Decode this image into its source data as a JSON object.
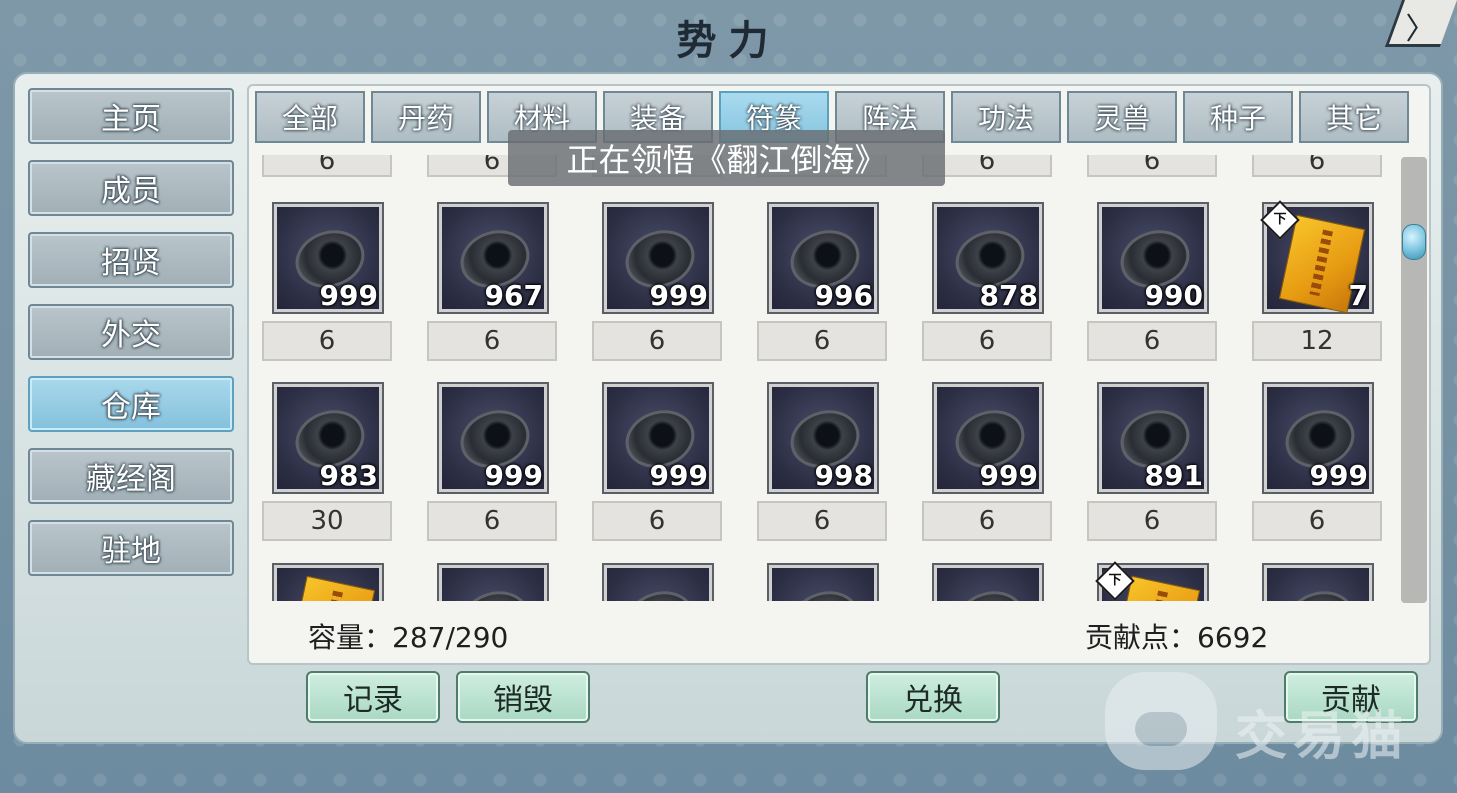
{
  "header": {
    "title": "势力",
    "close_symbol": "〉"
  },
  "sidebar": {
    "items": [
      {
        "label": "主页",
        "active": false
      },
      {
        "label": "成员",
        "active": false
      },
      {
        "label": "招贤",
        "active": false
      },
      {
        "label": "外交",
        "active": false
      },
      {
        "label": "仓库",
        "active": true
      },
      {
        "label": "藏经阁",
        "active": false
      },
      {
        "label": "驻地",
        "active": false
      }
    ]
  },
  "tabs": [
    {
      "label": "全部",
      "active": false
    },
    {
      "label": "丹药",
      "active": false
    },
    {
      "label": "材料",
      "active": false
    },
    {
      "label": "装备",
      "active": false
    },
    {
      "label": "符篆",
      "active": true
    },
    {
      "label": "阵法",
      "active": false
    },
    {
      "label": "功法",
      "active": false
    },
    {
      "label": "灵兽",
      "active": false
    },
    {
      "label": "种子",
      "active": false
    },
    {
      "label": "其它",
      "active": false
    }
  ],
  "toast": "正在领悟《翻江倒海》",
  "grid": {
    "top_costs": [
      "6",
      "6",
      "",
      "",
      "6",
      "6",
      "6"
    ],
    "rows": [
      [
        {
          "icon": "stone-icon",
          "qty": "999",
          "cost": "6",
          "tag": ""
        },
        {
          "icon": "stone-icon",
          "qty": "967",
          "cost": "6",
          "tag": ""
        },
        {
          "icon": "stone-icon",
          "qty": "999",
          "cost": "6",
          "tag": ""
        },
        {
          "icon": "stone-icon",
          "qty": "996",
          "cost": "6",
          "tag": ""
        },
        {
          "icon": "stone-icon",
          "qty": "878",
          "cost": "6",
          "tag": ""
        },
        {
          "icon": "stone-icon",
          "qty": "990",
          "cost": "6",
          "tag": ""
        },
        {
          "icon": "talisman-icon",
          "qty": "7",
          "cost": "12",
          "tag": "下"
        }
      ],
      [
        {
          "icon": "stone-icon",
          "qty": "983",
          "cost": "30",
          "tag": ""
        },
        {
          "icon": "stone-icon",
          "qty": "999",
          "cost": "6",
          "tag": ""
        },
        {
          "icon": "stone-icon",
          "qty": "999",
          "cost": "6",
          "tag": ""
        },
        {
          "icon": "stone-icon",
          "qty": "998",
          "cost": "6",
          "tag": ""
        },
        {
          "icon": "stone-icon",
          "qty": "999",
          "cost": "6",
          "tag": ""
        },
        {
          "icon": "stone-icon",
          "qty": "891",
          "cost": "6",
          "tag": ""
        },
        {
          "icon": "stone-icon",
          "qty": "999",
          "cost": "6",
          "tag": ""
        }
      ],
      [
        {
          "icon": "talisman-icon",
          "qty": "",
          "cost": "",
          "tag": ""
        },
        {
          "icon": "stone-icon",
          "qty": "",
          "cost": "",
          "tag": ""
        },
        {
          "icon": "stone-icon",
          "qty": "",
          "cost": "",
          "tag": ""
        },
        {
          "icon": "stone-icon",
          "qty": "",
          "cost": "",
          "tag": ""
        },
        {
          "icon": "stone-icon",
          "qty": "",
          "cost": "",
          "tag": ""
        },
        {
          "icon": "talisman-icon",
          "qty": "",
          "cost": "",
          "tag": "下"
        },
        {
          "icon": "stone-icon",
          "qty": "",
          "cost": "",
          "tag": ""
        }
      ]
    ]
  },
  "footer": {
    "capacity_label": "容量：",
    "capacity_value": "287/290",
    "contribution_label": "贡献点：",
    "contribution_value": "6692"
  },
  "actions": {
    "record": "记录",
    "destroy": "销毁",
    "exchange": "兑换",
    "contribute": "贡献"
  },
  "watermark": {
    "text": "交易猫"
  }
}
